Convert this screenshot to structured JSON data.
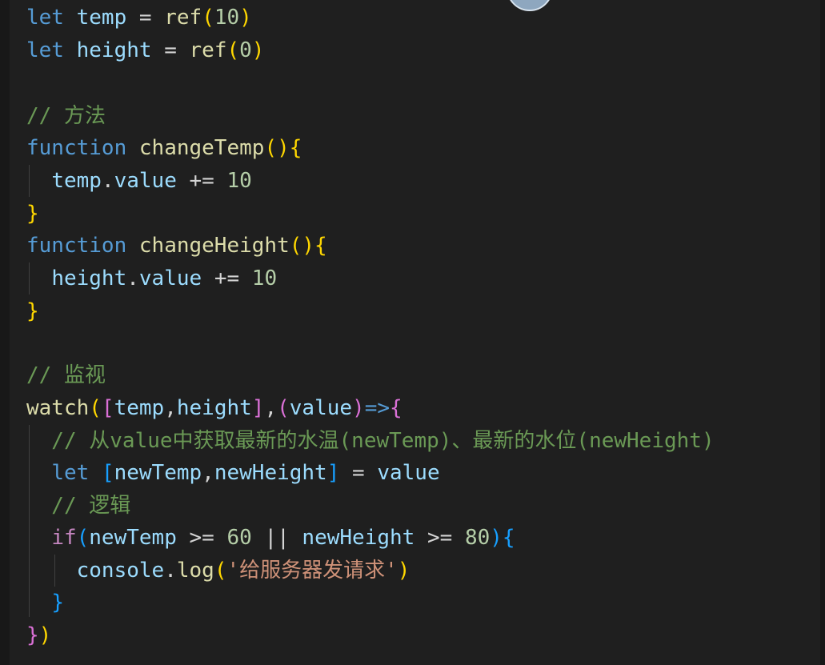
{
  "editor": {
    "language": "JavaScript (Vue)",
    "colors": {
      "background": "#1f1f1f",
      "keyword": "#569cd6",
      "control_keyword": "#c586c0",
      "function": "#dcdcaa",
      "variable": "#9cdcfe",
      "number": "#b5cea8",
      "comment": "#6a9955",
      "string": "#ce9178",
      "bracket_level_1": "#ffd700",
      "bracket_level_2": "#da70d6",
      "bracket_level_3": "#179fff"
    },
    "lines": [
      {
        "text": "let temp = ref(10)"
      },
      {
        "text": "let height = ref(0)"
      },
      {
        "text": ""
      },
      {
        "text": "// 方法"
      },
      {
        "text": "function changeTemp(){"
      },
      {
        "text": "  temp.value += 10"
      },
      {
        "text": "}"
      },
      {
        "text": "function changeHeight(){"
      },
      {
        "text": "  height.value += 10"
      },
      {
        "text": "}"
      },
      {
        "text": ""
      },
      {
        "text": "// 监视"
      },
      {
        "text": "watch([temp,height],(value)=>{"
      },
      {
        "text": "  // 从value中获取最新的水温(newTemp)、最新的水位(newHeight)"
      },
      {
        "text": "  let [newTemp,newHeight] = value"
      },
      {
        "text": "  // 逻辑"
      },
      {
        "text": "  if(newTemp >= 60 || newHeight >= 80){"
      },
      {
        "text": "    console.log('给服务器发请求')"
      },
      {
        "text": "  }"
      },
      {
        "text": "})"
      }
    ]
  }
}
